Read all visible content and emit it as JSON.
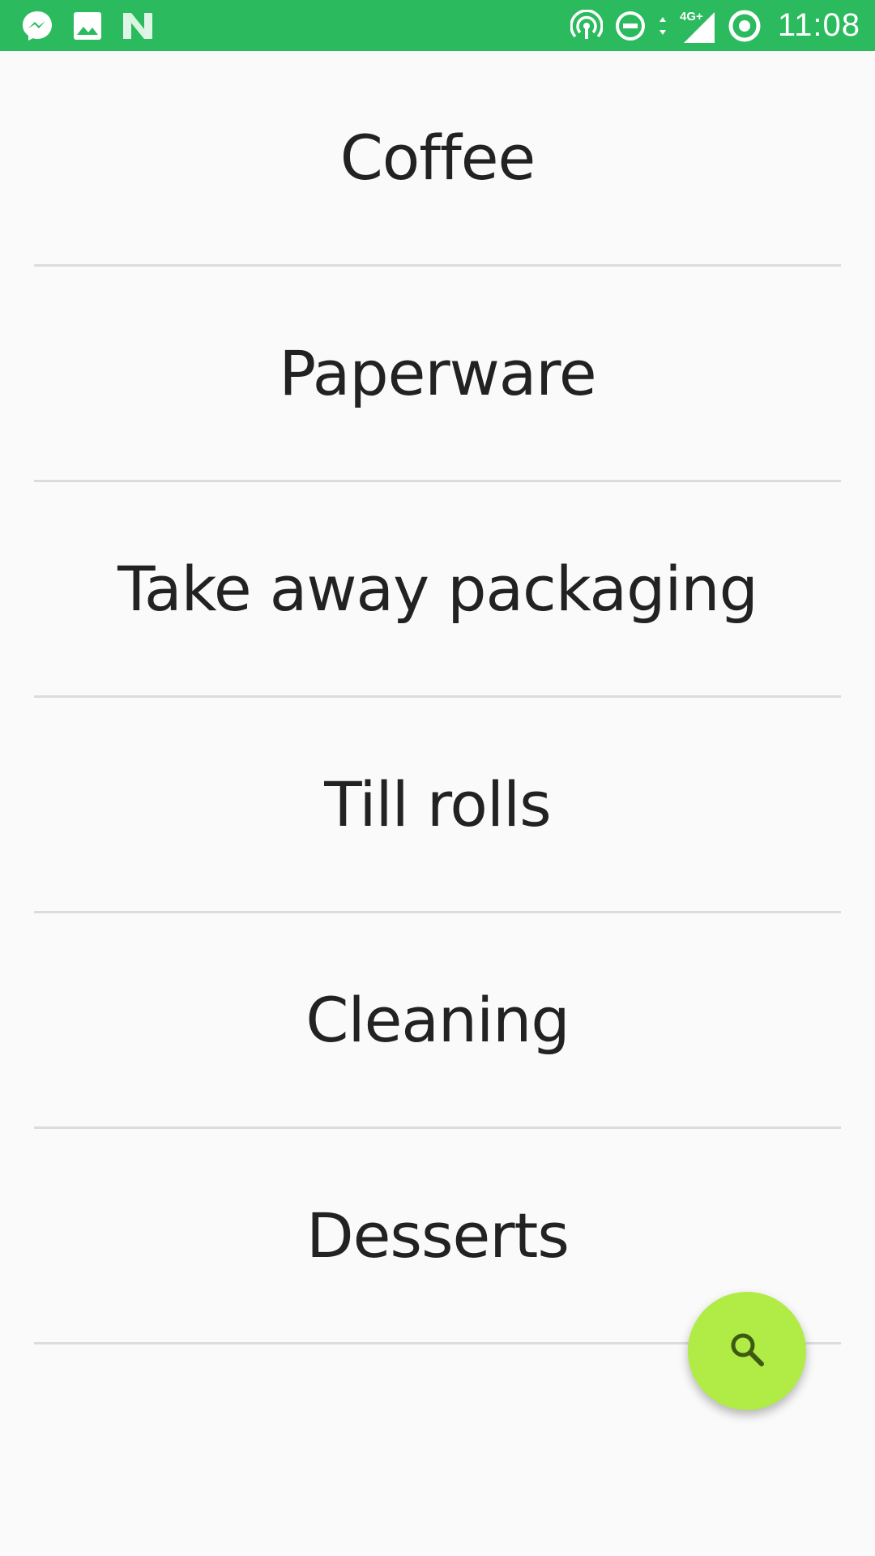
{
  "status_bar": {
    "time": "11:08",
    "network": "4G+",
    "icons_left": [
      "messenger-icon",
      "gallery-icon",
      "n-app-icon"
    ],
    "icons_right": [
      "hotspot-icon",
      "do-not-disturb-icon",
      "data-arrows-icon",
      "signal-icon",
      "ring-icon"
    ],
    "color": "#2bbb5e"
  },
  "categories": [
    {
      "label": "Coffee"
    },
    {
      "label": "Paperware"
    },
    {
      "label": "Take away packaging"
    },
    {
      "label": "Till rolls"
    },
    {
      "label": "Cleaning"
    },
    {
      "label": "Desserts"
    }
  ],
  "fab": {
    "icon": "search-icon",
    "color": "#b0ec45"
  }
}
